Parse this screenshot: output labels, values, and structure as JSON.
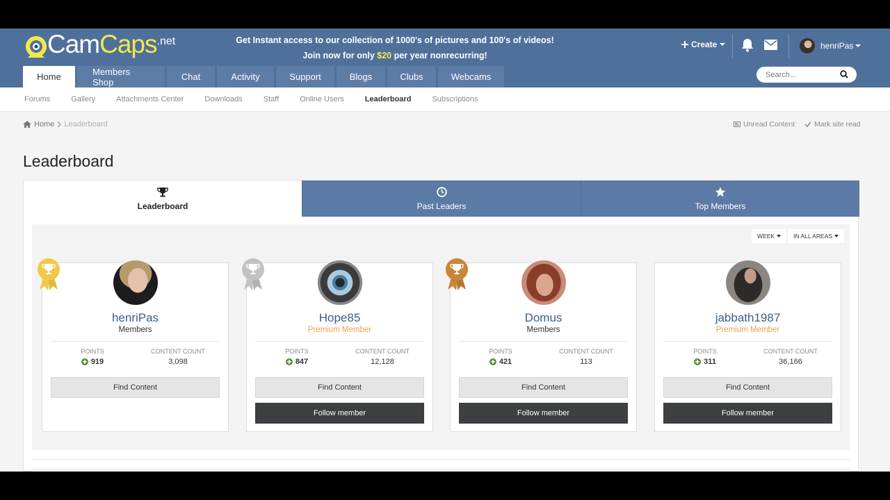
{
  "logo": {
    "part1": "Cam",
    "part2": "Caps",
    "part3": ".net"
  },
  "promo": {
    "line1": "Get Instant access to our collection of 1000's of pictures and 100's of videos!",
    "line2_pre": "Join now for only ",
    "line2_price": "$20",
    "line2_post": " per year nonrecurring!"
  },
  "header": {
    "create_label": "Create",
    "user_name": "henriPas"
  },
  "nav": {
    "tabs": [
      "Home",
      "Members Shop",
      "Chat",
      "Activity",
      "Support",
      "Blogs",
      "Clubs",
      "Webcams"
    ]
  },
  "search": {
    "placeholder": "Search..."
  },
  "subnav": {
    "items": [
      "Forums",
      "Gallery",
      "Attachments Center",
      "Downloads",
      "Staff",
      "Online Users",
      "Leaderboard",
      "Subscriptions"
    ]
  },
  "breadcrumb": {
    "home": "Home",
    "current": "Leaderboard"
  },
  "crumb_actions": {
    "unread": "Unread Content",
    "mark_read": "Mark site read"
  },
  "page": {
    "title": "Leaderboard"
  },
  "lb_tabs": [
    "Leaderboard",
    "Past Leaders",
    "Top Members"
  ],
  "filters": {
    "period": "Week",
    "area": "In All Areas"
  },
  "stat_labels": {
    "points": "Points",
    "content_count": "Content Count"
  },
  "buttons": {
    "find": "Find Content",
    "follow": "Follow member"
  },
  "colors": {
    "gold": "#f1c84a",
    "silver": "#c2c2c2",
    "bronze": "#c9853b",
    "header_blue": "#50709c",
    "premium": "#e8a24a"
  },
  "leaders": [
    {
      "name": "henriPas",
      "group": "Members",
      "points": "919",
      "content_count": "3,098"
    },
    {
      "name": "Hope85",
      "group": "Premium Member",
      "points": "847",
      "content_count": "12,128"
    },
    {
      "name": "Domus",
      "group": "Members",
      "points": "421",
      "content_count": "113"
    },
    {
      "name": "jabbath1987",
      "group": "Premium Member",
      "points": "311",
      "content_count": "36,166"
    }
  ]
}
